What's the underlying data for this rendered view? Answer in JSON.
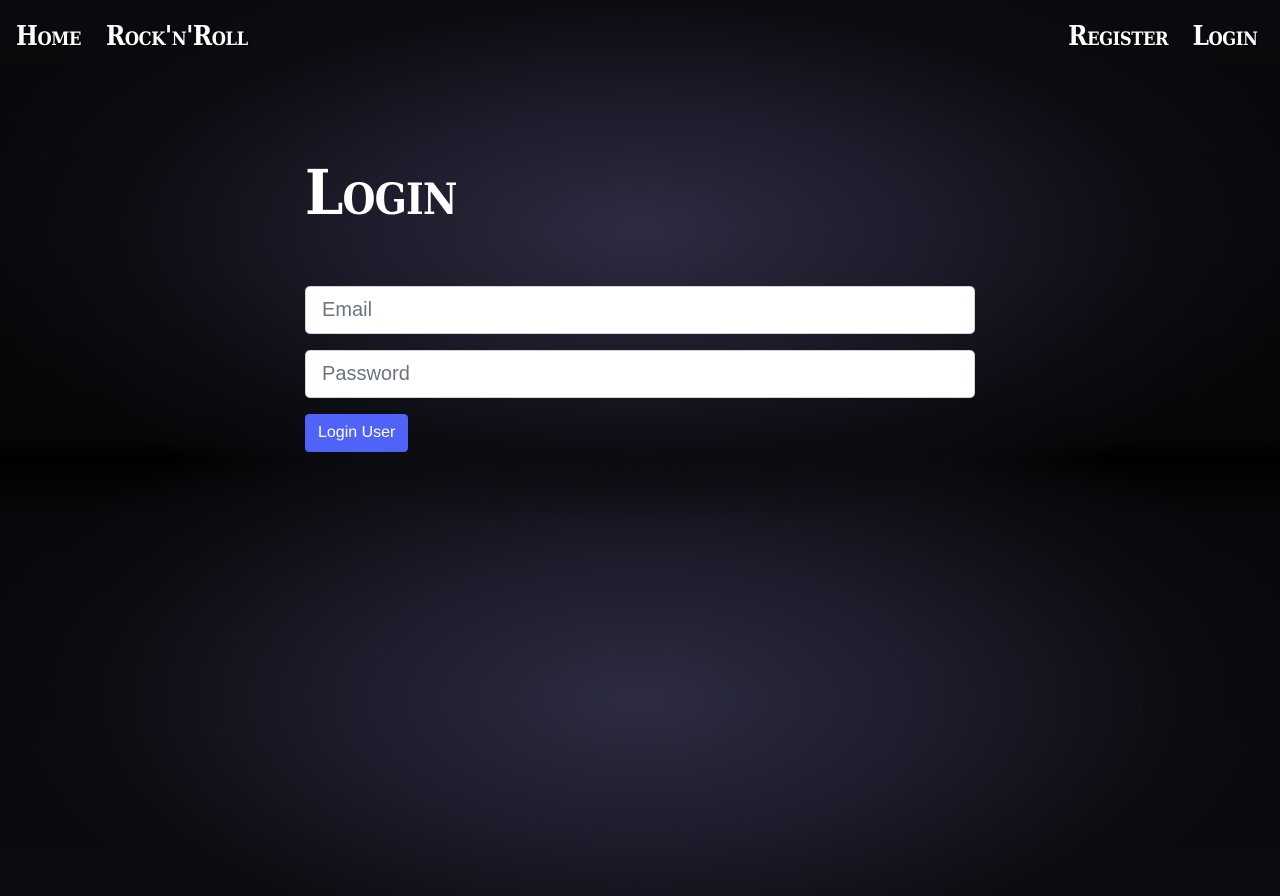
{
  "nav": {
    "left": [
      {
        "label": "Home"
      },
      {
        "label": "Rock'n'Roll"
      }
    ],
    "right": [
      {
        "label": "Register"
      },
      {
        "label": "Login"
      }
    ]
  },
  "page": {
    "title": "Login"
  },
  "form": {
    "email": {
      "value": "",
      "placeholder": "Email"
    },
    "password": {
      "value": "",
      "placeholder": "Password"
    },
    "submit_label": "Login User"
  },
  "colors": {
    "accent": "#4f63f9",
    "text": "#ffffff",
    "background": "#1d1c2b"
  }
}
